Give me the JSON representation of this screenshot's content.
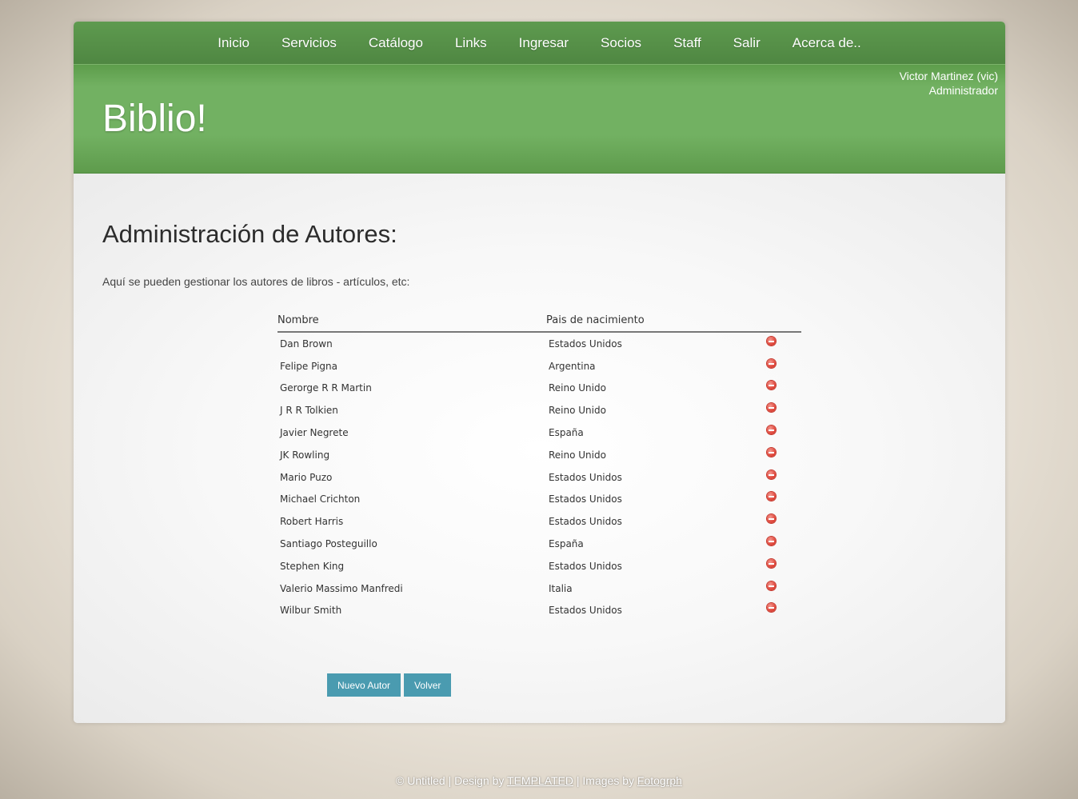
{
  "nav": {
    "items": [
      {
        "label": "Inicio"
      },
      {
        "label": "Servicios"
      },
      {
        "label": "Catálogo"
      },
      {
        "label": "Links"
      },
      {
        "label": "Ingresar"
      },
      {
        "label": "Socios"
      },
      {
        "label": "Staff"
      },
      {
        "label": "Salir"
      },
      {
        "label": "Acerca de.."
      }
    ]
  },
  "header": {
    "logo": "Biblio!",
    "user_name": "Victor Martinez (vic)",
    "user_role": "Administrador"
  },
  "main": {
    "title": "Administración de Autores:",
    "intro": "Aquí se pueden gestionar los autores de libros - artículos, etc:",
    "table": {
      "headers": [
        "Nombre",
        "Pais de nacimiento"
      ],
      "rows": [
        {
          "name": "Dan Brown",
          "country": "Estados Unidos"
        },
        {
          "name": "Felipe Pigna",
          "country": "Argentina"
        },
        {
          "name": "Gerorge R R Martin",
          "country": "Reino Unido"
        },
        {
          "name": "J R R Tolkien",
          "country": "Reino Unido"
        },
        {
          "name": "Javier Negrete",
          "country": "España"
        },
        {
          "name": "JK Rowling",
          "country": "Reino Unido"
        },
        {
          "name": "Mario Puzo",
          "country": "Estados Unidos"
        },
        {
          "name": "Michael Crichton",
          "country": "Estados Unidos"
        },
        {
          "name": "Robert Harris",
          "country": "Estados Unidos"
        },
        {
          "name": "Santiago Posteguillo",
          "country": "España"
        },
        {
          "name": "Stephen King",
          "country": "Estados Unidos"
        },
        {
          "name": "Valerio Massimo Manfredi",
          "country": "Italia"
        },
        {
          "name": "Wilbur Smith",
          "country": "Estados Unidos"
        }
      ],
      "row_action_icon": "delete-icon"
    },
    "buttons": {
      "new_author": "Nuevo Autor",
      "back": "Volver"
    }
  },
  "footer": {
    "prefix": "© Untitled | Design by ",
    "design_link": "TEMPLATED",
    "middle": " | Images by ",
    "images_link": "Fotogrph"
  },
  "colors": {
    "nav_green": "#4f8742",
    "header_green": "#72b162",
    "button_blue": "#4a9bb0",
    "delete_red": "#e0473b"
  }
}
